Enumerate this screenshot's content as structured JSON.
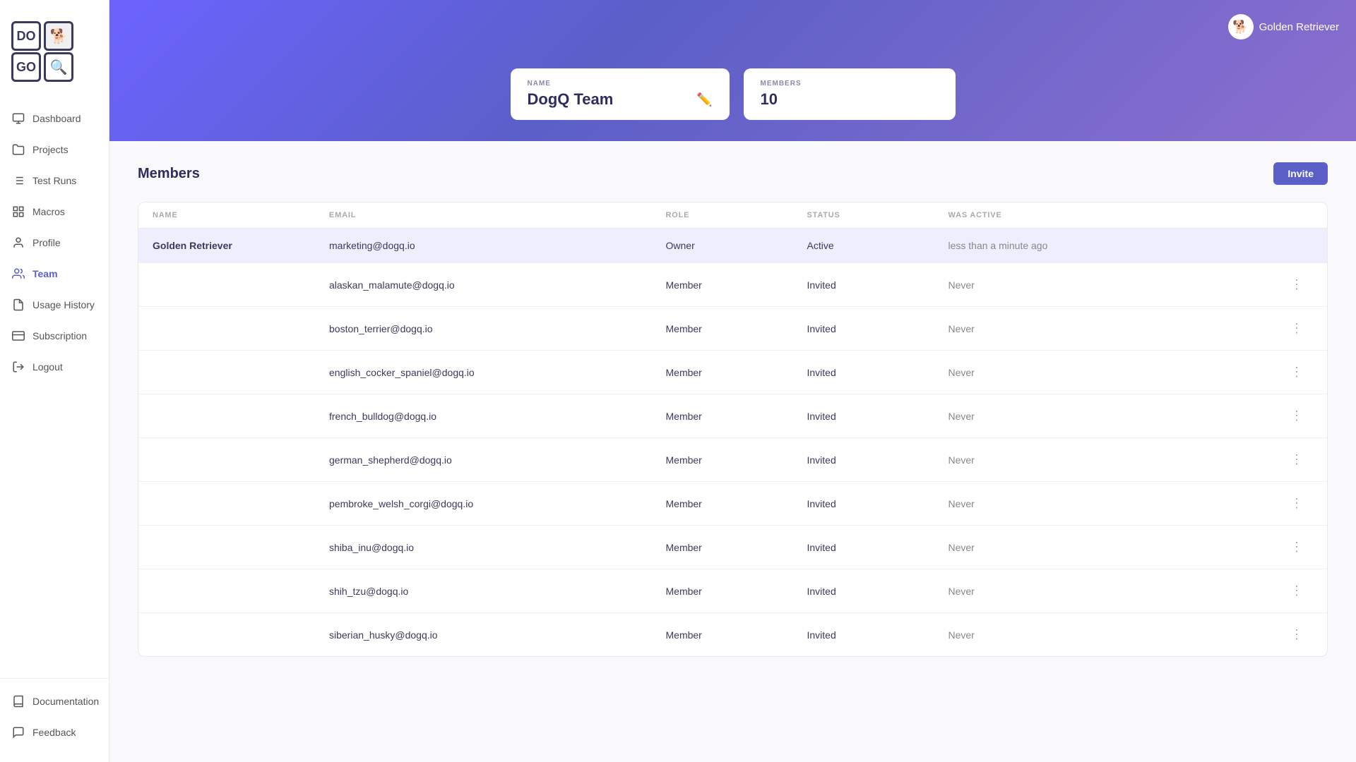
{
  "app": {
    "name": "DogQ",
    "logo_letters": [
      "DO",
      "GO"
    ],
    "logo_icons": [
      "🐶",
      "🔍"
    ]
  },
  "header": {
    "user": "Golden Retriever",
    "team_name_label": "NAME",
    "team_name_value": "DogQ Team",
    "members_label": "MEMBERS",
    "members_count": "10"
  },
  "sidebar": {
    "nav_items": [
      {
        "id": "dashboard",
        "label": "Dashboard",
        "icon": "monitor"
      },
      {
        "id": "projects",
        "label": "Projects",
        "icon": "folder"
      },
      {
        "id": "test-runs",
        "label": "Test Runs",
        "icon": "list"
      },
      {
        "id": "macros",
        "label": "Macros",
        "icon": "grid"
      },
      {
        "id": "profile",
        "label": "Profile",
        "icon": "user"
      },
      {
        "id": "team",
        "label": "Team",
        "icon": "users",
        "active": true
      },
      {
        "id": "usage-history",
        "label": "Usage History",
        "icon": "file"
      },
      {
        "id": "subscription",
        "label": "Subscription",
        "icon": "credit-card"
      },
      {
        "id": "logout",
        "label": "Logout",
        "icon": "log-out"
      }
    ],
    "bottom_items": [
      {
        "id": "documentation",
        "label": "Documentation",
        "icon": "book"
      },
      {
        "id": "feedback",
        "label": "Feedback",
        "icon": "message-circle"
      }
    ]
  },
  "members_section": {
    "title": "Members",
    "invite_label": "Invite",
    "columns": [
      "NAME",
      "EMAIL",
      "ROLE",
      "STATUS",
      "WAS ACTIVE",
      ""
    ],
    "rows": [
      {
        "name": "Golden Retriever",
        "email": "marketing@dogq.io",
        "role": "Owner",
        "status": "Active",
        "was_active": "less than a minute ago",
        "highlighted": true
      },
      {
        "name": "",
        "email": "alaskan_malamute@dogq.io",
        "role": "Member",
        "status": "Invited",
        "was_active": "Never",
        "highlighted": false
      },
      {
        "name": "",
        "email": "boston_terrier@dogq.io",
        "role": "Member",
        "status": "Invited",
        "was_active": "Never",
        "highlighted": false
      },
      {
        "name": "",
        "email": "english_cocker_spaniel@dogq.io",
        "role": "Member",
        "status": "Invited",
        "was_active": "Never",
        "highlighted": false
      },
      {
        "name": "",
        "email": "french_bulldog@dogq.io",
        "role": "Member",
        "status": "Invited",
        "was_active": "Never",
        "highlighted": false
      },
      {
        "name": "",
        "email": "german_shepherd@dogq.io",
        "role": "Member",
        "status": "Invited",
        "was_active": "Never",
        "highlighted": false
      },
      {
        "name": "",
        "email": "pembroke_welsh_corgi@dogq.io",
        "role": "Member",
        "status": "Invited",
        "was_active": "Never",
        "highlighted": false
      },
      {
        "name": "",
        "email": "shiba_inu@dogq.io",
        "role": "Member",
        "status": "Invited",
        "was_active": "Never",
        "highlighted": false
      },
      {
        "name": "",
        "email": "shih_tzu@dogq.io",
        "role": "Member",
        "status": "Invited",
        "was_active": "Never",
        "highlighted": false
      },
      {
        "name": "",
        "email": "siberian_husky@dogq.io",
        "role": "Member",
        "status": "Invited",
        "was_active": "Never",
        "highlighted": false
      }
    ]
  }
}
